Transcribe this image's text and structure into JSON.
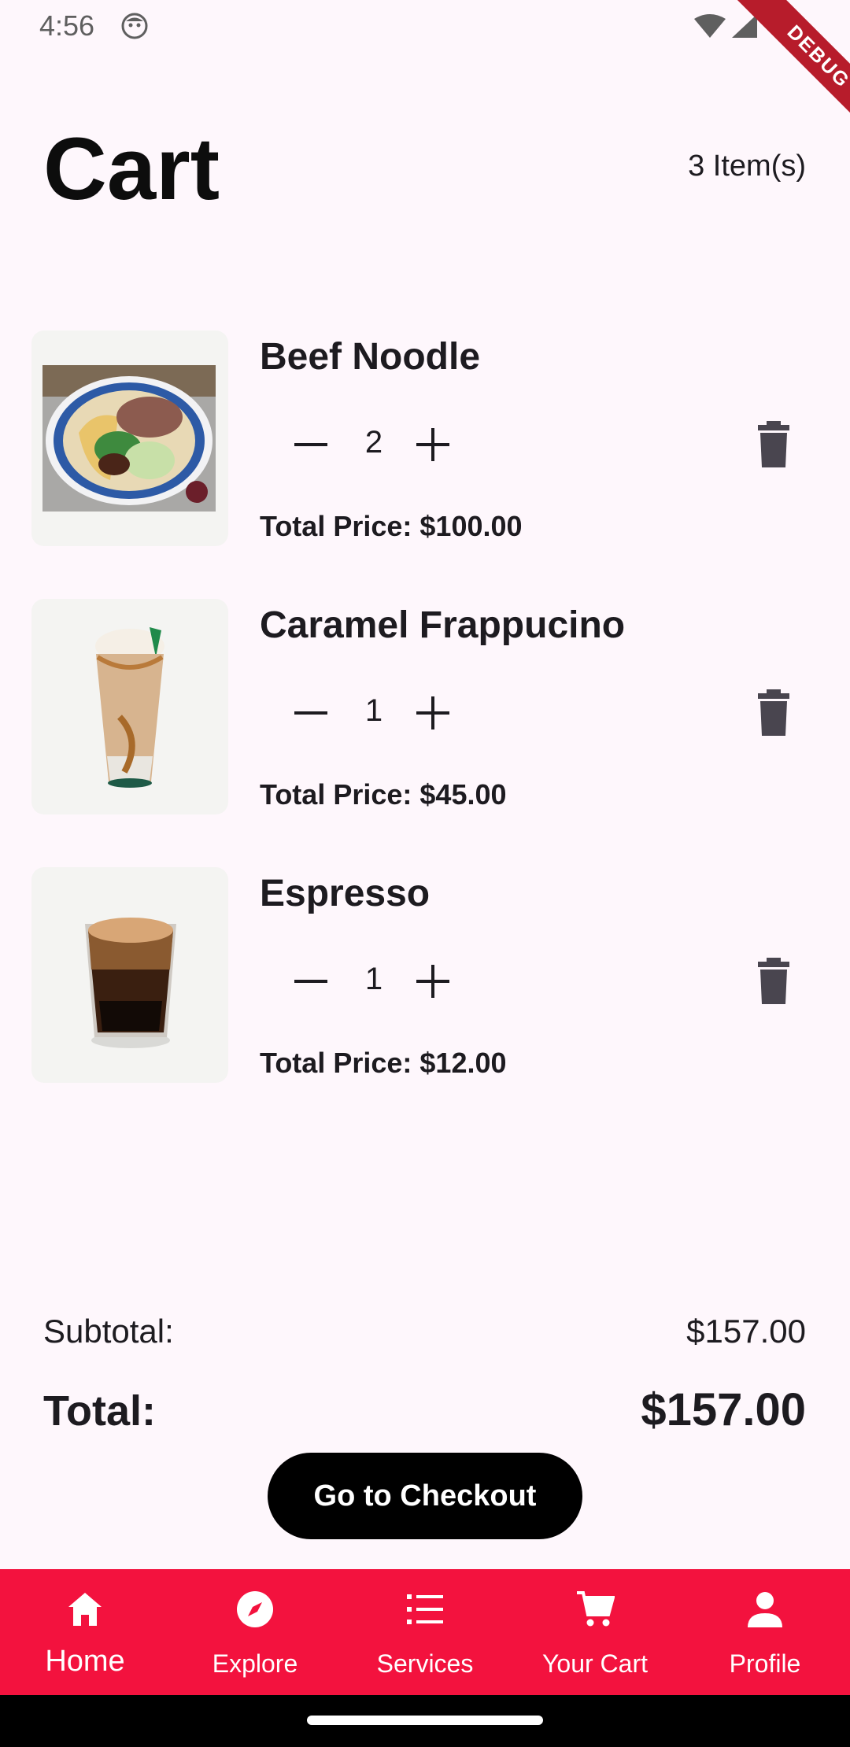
{
  "status_bar": {
    "time": "4:56"
  },
  "debug_banner": "DEBUG",
  "header": {
    "title": "Cart",
    "item_count": "3 Item(s)"
  },
  "cart": {
    "items": [
      {
        "name": "Beef Noodle",
        "quantity": "2",
        "total_label": "Total Price:",
        "total_value": "$100.00",
        "image": "beef-noodle-bowl"
      },
      {
        "name": "Caramel Frappucino",
        "quantity": "1",
        "total_label": "Total Price:",
        "total_value": "$45.00",
        "image": "caramel-frappuccino-cup"
      },
      {
        "name": "Espresso",
        "quantity": "1",
        "total_label": "Total Price:",
        "total_value": "$12.00",
        "image": "espresso-shot-glass"
      }
    ]
  },
  "summary": {
    "subtotal_label": "Subtotal:",
    "subtotal_value": "$157.00",
    "total_label": "Total:",
    "total_value": "$157.00"
  },
  "checkout_button": "Go to Checkout",
  "bottom_nav": {
    "background": "#F3123E",
    "items": [
      {
        "label": "Home",
        "icon": "home-icon",
        "active": true
      },
      {
        "label": "Explore",
        "icon": "compass-icon"
      },
      {
        "label": "Services",
        "icon": "list-icon"
      },
      {
        "label": "Your Cart",
        "icon": "cart-icon"
      },
      {
        "label": "Profile",
        "icon": "person-icon"
      }
    ]
  },
  "colors": {
    "accent": "#F3123E",
    "background": "#FEF7FC",
    "text": "#1D1B20",
    "button": "#000000"
  }
}
